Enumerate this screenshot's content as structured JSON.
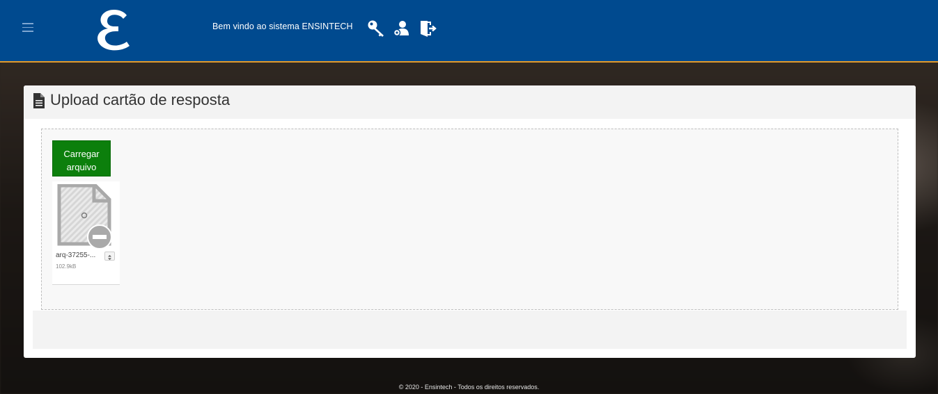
{
  "header": {
    "welcome_text": "Bem vindo ao sistema ENSINTECH",
    "logo_letter": "ℰ",
    "brand_color": "#004a8f",
    "accent_color": "#e39a2b",
    "icons": [
      "menu-icon",
      "key-icon",
      "user-settings-icon",
      "logout-icon"
    ]
  },
  "panel": {
    "title": "Upload cartão de resposta",
    "title_icon": "document-icon"
  },
  "dropzone": {
    "upload_button_label": "Carregar arquivo",
    "upload_button_color": "#0c7f0c",
    "files": [
      {
        "name": "arq-37255-...",
        "size": "102.9kB"
      }
    ]
  },
  "footer": {
    "text": "© 2020 - Ensintech - Todos os direitos reservados."
  }
}
